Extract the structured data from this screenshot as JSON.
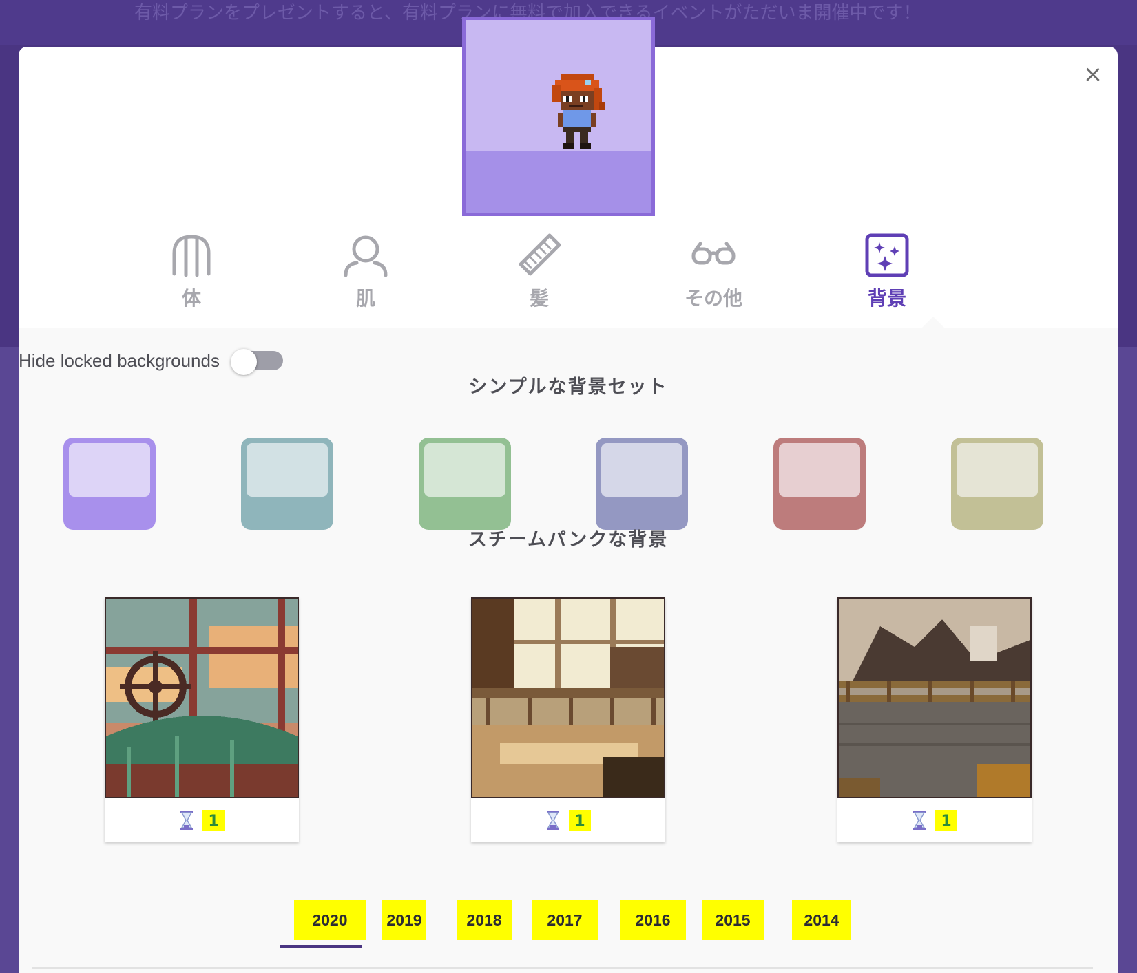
{
  "banner": {
    "text": "有料プランをプレゼントすると、有料プランに無料で加入できるイベントがただいま開催中です！"
  },
  "modal": {
    "close_label": "×"
  },
  "tabs": [
    {
      "label": "体",
      "icon": "body-icon",
      "active": false
    },
    {
      "label": "肌",
      "icon": "skin-icon",
      "active": false
    },
    {
      "label": "髪",
      "icon": "comb-icon",
      "active": false
    },
    {
      "label": "その他",
      "icon": "glasses-icon",
      "active": false
    },
    {
      "label": "背景",
      "icon": "sparkle-background-icon",
      "active": true
    }
  ],
  "toggle": {
    "label": "Hide locked backgrounds",
    "checked": false
  },
  "sections": {
    "simple_title": "シンプルな背景セット",
    "steampunk_title": "スチームパンクな背景"
  },
  "simple_backgrounds": [
    {
      "outer": "#a890ec",
      "inner": "#ddd4f7"
    },
    {
      "outer": "#8fb5bb",
      "inner": "#d2e1e4"
    },
    {
      "outer": "#93c093",
      "inner": "#d5e6d5"
    },
    {
      "outer": "#9498c2",
      "inner": "#d5d7e8"
    },
    {
      "outer": "#bd7c7c",
      "inner": "#e7cfd1"
    },
    {
      "outer": "#c2c096",
      "inner": "#e5e4d5"
    }
  ],
  "steampunk_backgrounds": [
    {
      "price": "1",
      "icon": "hourglass-icon"
    },
    {
      "price": "1",
      "icon": "hourglass-icon"
    },
    {
      "price": "1",
      "icon": "hourglass-icon"
    }
  ],
  "years": [
    "2020",
    "2019",
    "2018",
    "2017",
    "2016",
    "2015",
    "2014"
  ],
  "selected_year": "2020",
  "colors": {
    "accent": "#5f3fb5",
    "highlight": "#ffff00",
    "inactive_tab": "#a7a7ad"
  }
}
